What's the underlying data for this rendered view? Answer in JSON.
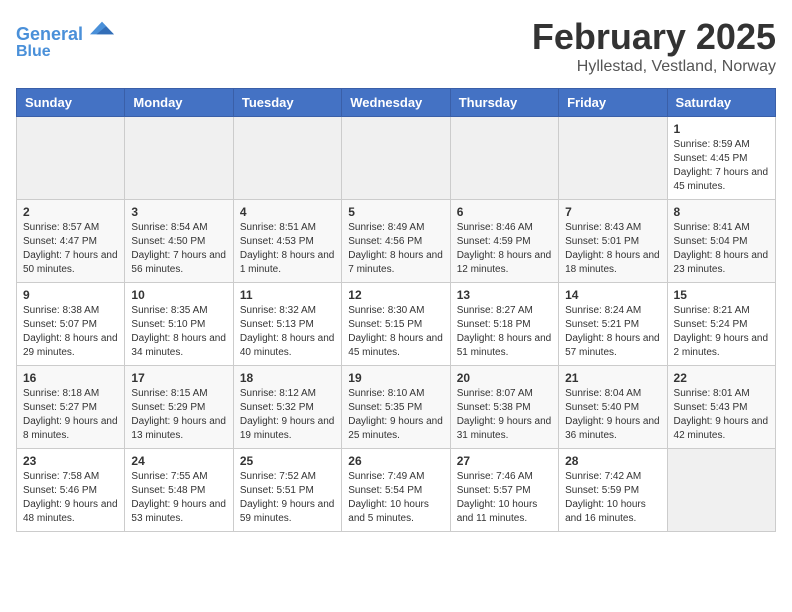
{
  "header": {
    "logo_line1": "General",
    "logo_line2": "Blue",
    "title": "February 2025",
    "location": "Hyllestad, Vestland, Norway"
  },
  "days_of_week": [
    "Sunday",
    "Monday",
    "Tuesday",
    "Wednesday",
    "Thursday",
    "Friday",
    "Saturday"
  ],
  "weeks": [
    [
      {
        "day": "",
        "info": ""
      },
      {
        "day": "",
        "info": ""
      },
      {
        "day": "",
        "info": ""
      },
      {
        "day": "",
        "info": ""
      },
      {
        "day": "",
        "info": ""
      },
      {
        "day": "",
        "info": ""
      },
      {
        "day": "1",
        "info": "Sunrise: 8:59 AM\nSunset: 4:45 PM\nDaylight: 7 hours and 45 minutes."
      }
    ],
    [
      {
        "day": "2",
        "info": "Sunrise: 8:57 AM\nSunset: 4:47 PM\nDaylight: 7 hours and 50 minutes."
      },
      {
        "day": "3",
        "info": "Sunrise: 8:54 AM\nSunset: 4:50 PM\nDaylight: 7 hours and 56 minutes."
      },
      {
        "day": "4",
        "info": "Sunrise: 8:51 AM\nSunset: 4:53 PM\nDaylight: 8 hours and 1 minute."
      },
      {
        "day": "5",
        "info": "Sunrise: 8:49 AM\nSunset: 4:56 PM\nDaylight: 8 hours and 7 minutes."
      },
      {
        "day": "6",
        "info": "Sunrise: 8:46 AM\nSunset: 4:59 PM\nDaylight: 8 hours and 12 minutes."
      },
      {
        "day": "7",
        "info": "Sunrise: 8:43 AM\nSunset: 5:01 PM\nDaylight: 8 hours and 18 minutes."
      },
      {
        "day": "8",
        "info": "Sunrise: 8:41 AM\nSunset: 5:04 PM\nDaylight: 8 hours and 23 minutes."
      }
    ],
    [
      {
        "day": "9",
        "info": "Sunrise: 8:38 AM\nSunset: 5:07 PM\nDaylight: 8 hours and 29 minutes."
      },
      {
        "day": "10",
        "info": "Sunrise: 8:35 AM\nSunset: 5:10 PM\nDaylight: 8 hours and 34 minutes."
      },
      {
        "day": "11",
        "info": "Sunrise: 8:32 AM\nSunset: 5:13 PM\nDaylight: 8 hours and 40 minutes."
      },
      {
        "day": "12",
        "info": "Sunrise: 8:30 AM\nSunset: 5:15 PM\nDaylight: 8 hours and 45 minutes."
      },
      {
        "day": "13",
        "info": "Sunrise: 8:27 AM\nSunset: 5:18 PM\nDaylight: 8 hours and 51 minutes."
      },
      {
        "day": "14",
        "info": "Sunrise: 8:24 AM\nSunset: 5:21 PM\nDaylight: 8 hours and 57 minutes."
      },
      {
        "day": "15",
        "info": "Sunrise: 8:21 AM\nSunset: 5:24 PM\nDaylight: 9 hours and 2 minutes."
      }
    ],
    [
      {
        "day": "16",
        "info": "Sunrise: 8:18 AM\nSunset: 5:27 PM\nDaylight: 9 hours and 8 minutes."
      },
      {
        "day": "17",
        "info": "Sunrise: 8:15 AM\nSunset: 5:29 PM\nDaylight: 9 hours and 13 minutes."
      },
      {
        "day": "18",
        "info": "Sunrise: 8:12 AM\nSunset: 5:32 PM\nDaylight: 9 hours and 19 minutes."
      },
      {
        "day": "19",
        "info": "Sunrise: 8:10 AM\nSunset: 5:35 PM\nDaylight: 9 hours and 25 minutes."
      },
      {
        "day": "20",
        "info": "Sunrise: 8:07 AM\nSunset: 5:38 PM\nDaylight: 9 hours and 31 minutes."
      },
      {
        "day": "21",
        "info": "Sunrise: 8:04 AM\nSunset: 5:40 PM\nDaylight: 9 hours and 36 minutes."
      },
      {
        "day": "22",
        "info": "Sunrise: 8:01 AM\nSunset: 5:43 PM\nDaylight: 9 hours and 42 minutes."
      }
    ],
    [
      {
        "day": "23",
        "info": "Sunrise: 7:58 AM\nSunset: 5:46 PM\nDaylight: 9 hours and 48 minutes."
      },
      {
        "day": "24",
        "info": "Sunrise: 7:55 AM\nSunset: 5:48 PM\nDaylight: 9 hours and 53 minutes."
      },
      {
        "day": "25",
        "info": "Sunrise: 7:52 AM\nSunset: 5:51 PM\nDaylight: 9 hours and 59 minutes."
      },
      {
        "day": "26",
        "info": "Sunrise: 7:49 AM\nSunset: 5:54 PM\nDaylight: 10 hours and 5 minutes."
      },
      {
        "day": "27",
        "info": "Sunrise: 7:46 AM\nSunset: 5:57 PM\nDaylight: 10 hours and 11 minutes."
      },
      {
        "day": "28",
        "info": "Sunrise: 7:42 AM\nSunset: 5:59 PM\nDaylight: 10 hours and 16 minutes."
      },
      {
        "day": "",
        "info": ""
      }
    ]
  ]
}
